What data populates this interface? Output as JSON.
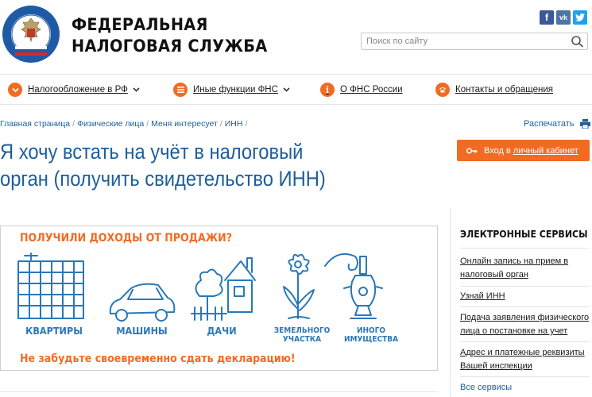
{
  "header": {
    "site_name_line1": "ФЕДЕРАЛЬНАЯ",
    "site_name_line2": "НАЛОГОВАЯ СЛУЖБА",
    "search_placeholder": "Поиск по сайту",
    "social": [
      {
        "icon": "facebook-icon",
        "glyph": "f"
      },
      {
        "icon": "vk-icon",
        "glyph": "vk"
      },
      {
        "icon": "twitter-icon",
        "glyph": "t"
      }
    ]
  },
  "nav": {
    "items": [
      {
        "label": "Налогообложение в РФ",
        "icon": "chevron-circle-icon",
        "has_dropdown": true
      },
      {
        "label": "Иные функции ФНС",
        "icon": "menu-circle-icon",
        "has_dropdown": true
      },
      {
        "label": "О ФНС России",
        "icon": "info-circle-icon",
        "has_dropdown": false
      },
      {
        "label": "Контакты и обращения",
        "icon": "phone-circle-icon",
        "has_dropdown": false
      }
    ]
  },
  "breadcrumb": [
    "Главная страница",
    "Физические лица",
    "Меня интересует",
    "ИНН"
  ],
  "print_label": "Распечатать",
  "page_title": "Я хочу встать на учёт в налоговый орган (получить свидетельство ИНН)",
  "cabinet_button": {
    "prefix": "Вход в",
    "link": "личный кабинет"
  },
  "banner": {
    "title": "ПОЛУЧИЛИ ДОХОДЫ ОТ ПРОДАЖИ?",
    "items": [
      {
        "label": "КВАРТИРЫ",
        "icon": "apartment-building-icon"
      },
      {
        "label": "МАШИНЫ",
        "icon": "car-icon"
      },
      {
        "label": "ДАЧИ",
        "icon": "country-house-icon"
      },
      {
        "label_line1": "ЗЕМЕЛЬНОГО",
        "label_line2": "УЧАСТКА",
        "icon": "flower-icon"
      },
      {
        "label_line1": "ИНОГО",
        "label_line2": "ИМУЩЕСТВА",
        "icon": "samovar-icon"
      }
    ],
    "footer": "Не забудьте своевременно сдать декларацию!"
  },
  "sidebar": {
    "title": "ЭЛЕКТРОННЫЕ СЕРВИСЫ",
    "links": [
      "Онлайн запись на прием в налоговый орган",
      "Узнай ИНН",
      "Подача заявления физического лица о постановке на учет",
      "Адрес и платежные реквизиты Вашей инспекции"
    ],
    "all_label": "Все сервисы"
  },
  "colors": {
    "accent": "#f26b22",
    "link_blue": "#1d5e9c",
    "banner_blue": "#2a78b8"
  }
}
